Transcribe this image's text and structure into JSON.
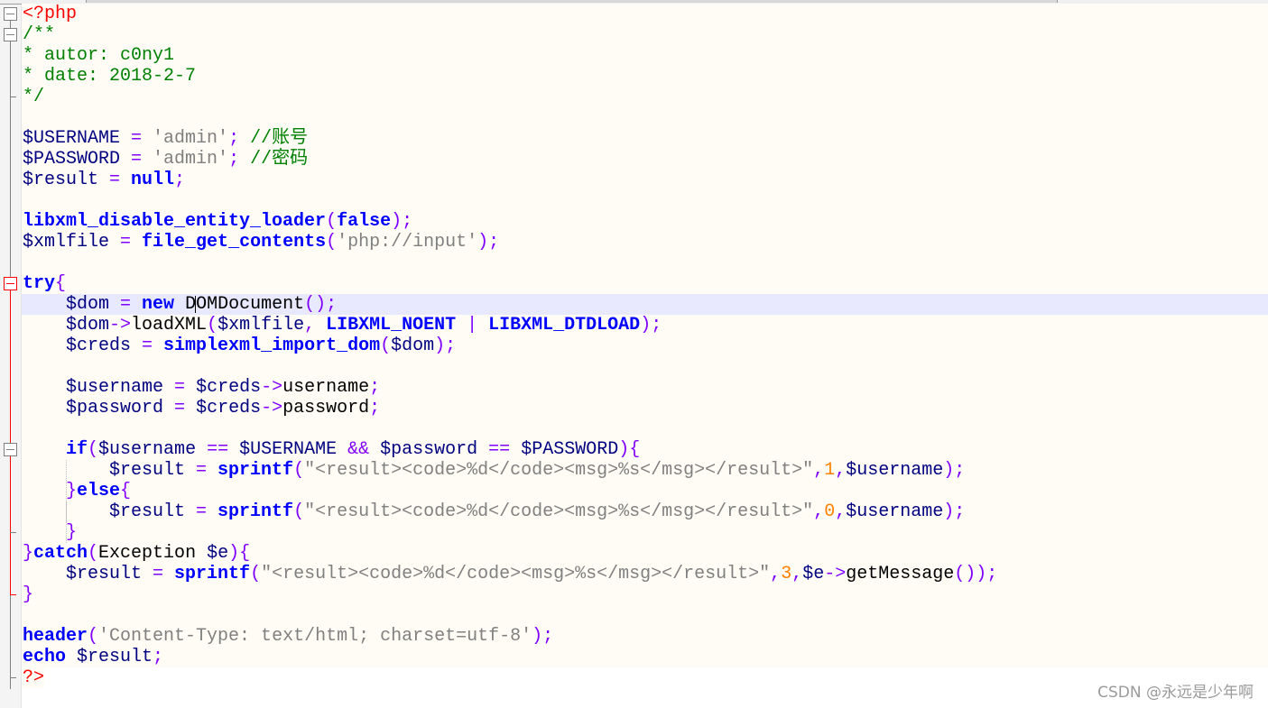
{
  "editor": {
    "current_line": 15,
    "colors": {
      "variable": "#000080",
      "operator": "#8000ff",
      "string": "#808080",
      "keyword": "#0000ff",
      "comment": "#008000",
      "number": "#ff8000",
      "php_tag": "#ff0000",
      "current_line_bg": "#e8e8ff",
      "background": "#fefcf5"
    },
    "lines": [
      [
        [
          "tag",
          "<?php"
        ]
      ],
      [
        [
          "cm",
          "/**"
        ]
      ],
      [
        [
          "cm",
          "* autor: c0ny1"
        ]
      ],
      [
        [
          "cm",
          "* date: 2018-2-7"
        ]
      ],
      [
        [
          "cm",
          "*/"
        ]
      ],
      [],
      [
        [
          "var",
          "$USERNAME "
        ],
        [
          "op",
          "= "
        ],
        [
          "str",
          "'admin'"
        ],
        [
          "op",
          "; "
        ],
        [
          "cm",
          "//账号"
        ]
      ],
      [
        [
          "var",
          "$PASSWORD "
        ],
        [
          "op",
          "= "
        ],
        [
          "str",
          "'admin'"
        ],
        [
          "op",
          "; "
        ],
        [
          "cm",
          "//密码"
        ]
      ],
      [
        [
          "var",
          "$result "
        ],
        [
          "op",
          "= "
        ],
        [
          "kw",
          "null"
        ],
        [
          "op",
          ";"
        ]
      ],
      [],
      [
        [
          "kw",
          "libxml_disable_entity_loader"
        ],
        [
          "op",
          "("
        ],
        [
          "kw",
          "false"
        ],
        [
          "op",
          ");"
        ]
      ],
      [
        [
          "var",
          "$xmlfile "
        ],
        [
          "op",
          "= "
        ],
        [
          "kw",
          "file_get_contents"
        ],
        [
          "op",
          "("
        ],
        [
          "str",
          "'php://input'"
        ],
        [
          "op",
          ");"
        ]
      ],
      [],
      [
        [
          "kw",
          "try"
        ],
        [
          "op",
          "{"
        ]
      ],
      [
        [
          "txt",
          "    "
        ],
        [
          "var",
          "$dom "
        ],
        [
          "op",
          "= "
        ],
        [
          "kw",
          "new "
        ],
        [
          "txt",
          "DOMDocument"
        ],
        [
          "op",
          "();"
        ]
      ],
      [
        [
          "txt",
          "    "
        ],
        [
          "var",
          "$dom"
        ],
        [
          "op",
          "->"
        ],
        [
          "txt",
          "loadXML"
        ],
        [
          "op",
          "("
        ],
        [
          "var",
          "$xmlfile"
        ],
        [
          "op",
          ", "
        ],
        [
          "kw",
          "LIBXML_NOENT "
        ],
        [
          "op",
          "| "
        ],
        [
          "kw",
          "LIBXML_DTDLOAD"
        ],
        [
          "op",
          ");"
        ]
      ],
      [
        [
          "txt",
          "    "
        ],
        [
          "var",
          "$creds "
        ],
        [
          "op",
          "= "
        ],
        [
          "kw",
          "simplexml_import_dom"
        ],
        [
          "op",
          "("
        ],
        [
          "var",
          "$dom"
        ],
        [
          "op",
          ");"
        ]
      ],
      [],
      [
        [
          "txt",
          "    "
        ],
        [
          "var",
          "$username "
        ],
        [
          "op",
          "= "
        ],
        [
          "var",
          "$creds"
        ],
        [
          "op",
          "->"
        ],
        [
          "txt",
          "username"
        ],
        [
          "op",
          ";"
        ]
      ],
      [
        [
          "txt",
          "    "
        ],
        [
          "var",
          "$password "
        ],
        [
          "op",
          "= "
        ],
        [
          "var",
          "$creds"
        ],
        [
          "op",
          "->"
        ],
        [
          "txt",
          "password"
        ],
        [
          "op",
          ";"
        ]
      ],
      [],
      [
        [
          "txt",
          "    "
        ],
        [
          "kw",
          "if"
        ],
        [
          "op",
          "("
        ],
        [
          "var",
          "$username "
        ],
        [
          "op",
          "== "
        ],
        [
          "var",
          "$USERNAME "
        ],
        [
          "op",
          "&& "
        ],
        [
          "var",
          "$password "
        ],
        [
          "op",
          "== "
        ],
        [
          "var",
          "$PASSWORD"
        ],
        [
          "op",
          "){"
        ]
      ],
      [
        [
          "txt",
          "        "
        ],
        [
          "var",
          "$result "
        ],
        [
          "op",
          "= "
        ],
        [
          "kw",
          "sprintf"
        ],
        [
          "op",
          "("
        ],
        [
          "str",
          "\"<result><code>%d</code><msg>%s</msg></result>\""
        ],
        [
          "op",
          ","
        ],
        [
          "num",
          "1"
        ],
        [
          "op",
          ","
        ],
        [
          "var",
          "$username"
        ],
        [
          "op",
          ");"
        ]
      ],
      [
        [
          "txt",
          "    "
        ],
        [
          "op",
          "}"
        ],
        [
          "kw",
          "else"
        ],
        [
          "op",
          "{"
        ]
      ],
      [
        [
          "txt",
          "        "
        ],
        [
          "var",
          "$result "
        ],
        [
          "op",
          "= "
        ],
        [
          "kw",
          "sprintf"
        ],
        [
          "op",
          "("
        ],
        [
          "str",
          "\"<result><code>%d</code><msg>%s</msg></result>\""
        ],
        [
          "op",
          ","
        ],
        [
          "num",
          "0"
        ],
        [
          "op",
          ","
        ],
        [
          "var",
          "$username"
        ],
        [
          "op",
          ");"
        ]
      ],
      [
        [
          "txt",
          "    "
        ],
        [
          "op",
          "}"
        ]
      ],
      [
        [
          "op",
          "}"
        ],
        [
          "kw",
          "catch"
        ],
        [
          "op",
          "("
        ],
        [
          "txt",
          "Exception "
        ],
        [
          "var",
          "$e"
        ],
        [
          "op",
          "){"
        ]
      ],
      [
        [
          "txt",
          "    "
        ],
        [
          "var",
          "$result "
        ],
        [
          "op",
          "= "
        ],
        [
          "kw",
          "sprintf"
        ],
        [
          "op",
          "("
        ],
        [
          "str",
          "\"<result><code>%d</code><msg>%s</msg></result>\""
        ],
        [
          "op",
          ","
        ],
        [
          "num",
          "3"
        ],
        [
          "op",
          ","
        ],
        [
          "var",
          "$e"
        ],
        [
          "op",
          "->"
        ],
        [
          "txt",
          "getMessage"
        ],
        [
          "op",
          "());"
        ]
      ],
      [
        [
          "op",
          "}"
        ]
      ],
      [],
      [
        [
          "kw",
          "header"
        ],
        [
          "op",
          "("
        ],
        [
          "str",
          "'Content-Type: text/html; charset=utf-8'"
        ],
        [
          "op",
          ");"
        ]
      ],
      [
        [
          "kw",
          "echo "
        ],
        [
          "var",
          "$result"
        ],
        [
          "op",
          ";"
        ]
      ],
      [
        [
          "tag",
          "?>"
        ]
      ]
    ]
  },
  "watermark": "CSDN @永远是少年啊"
}
